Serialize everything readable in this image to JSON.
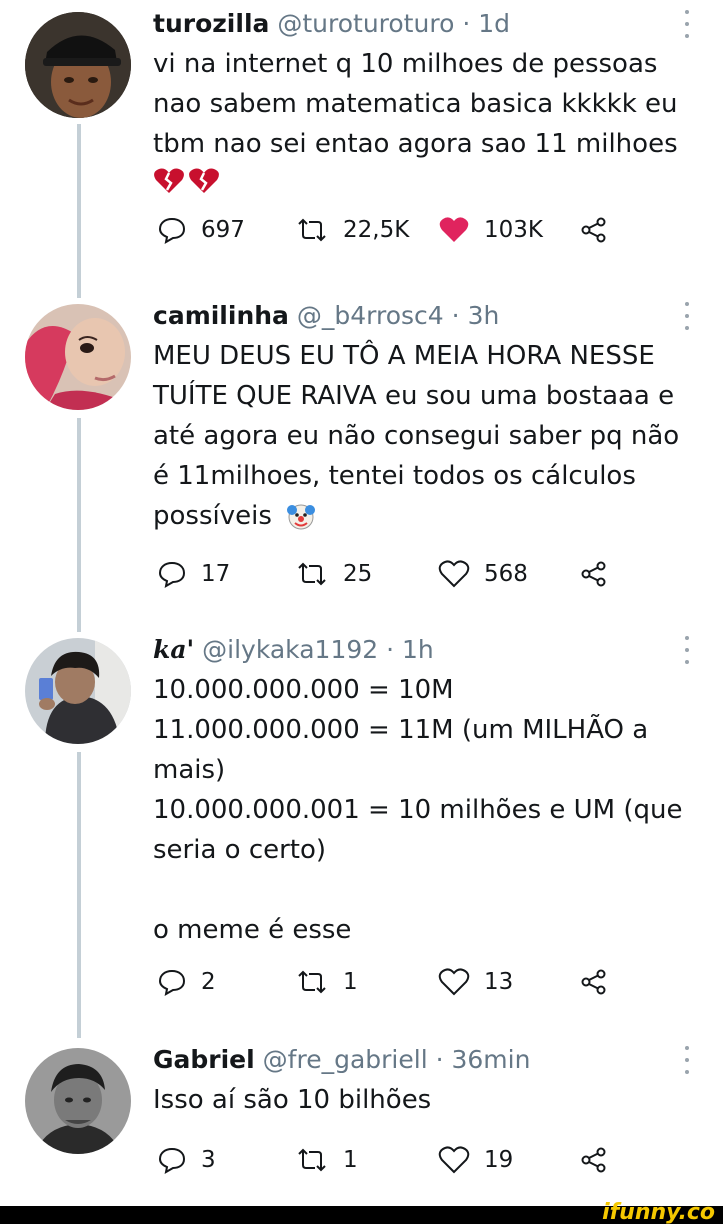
{
  "tweets": [
    {
      "name": "turozilla",
      "handle": "@turoturoturo",
      "time": "1d",
      "lines": [
        "vi na internet q 10 milhoes de pessoas",
        "nao sabem matematica basica kkkkk eu",
        "tbm nao sei entao agora sao 11 milhoes"
      ],
      "replies": "697",
      "retweets": "22,5K",
      "likes": "103K",
      "liked": true
    },
    {
      "name": "camilinha",
      "handle": "@_b4rrosc4",
      "time": "3h",
      "lines": [
        "MEU DEUS EU TÔ A MEIA HORA NESSE",
        "TUÍTE QUE RAIVA eu sou uma bostaaa e",
        "até agora eu não consegui saber pq não",
        "é 11milhoes, tentei todos os cálculos",
        "possíveis"
      ],
      "replies": "17",
      "retweets": "25",
      "likes": "568",
      "liked": false
    },
    {
      "name": "ka'",
      "handle": "@ilykaka1192",
      "time": "1h",
      "lines": [
        "10.000.000.000 = 10M",
        "11.000.000.000 = 11M (um MILHÃO a",
        "mais)",
        "10.000.000.001 = 10 milhões e UM (que",
        "seria o certo)",
        "",
        "o meme é esse"
      ],
      "replies": "2",
      "retweets": "1",
      "likes": "13",
      "liked": false
    },
    {
      "name": "Gabriel",
      "handle": "@fre_gabriell",
      "time": "36min",
      "lines": [
        "Isso aí são 10 bilhões"
      ],
      "replies": "3",
      "retweets": "1",
      "likes": "19",
      "liked": false
    }
  ],
  "separator": "·",
  "icons": {
    "reply": "reply-icon",
    "retweet": "retweet-icon",
    "like": "heart-icon",
    "share": "share-icon",
    "broken_heart": "broken-heart-emoji",
    "clown": "clown-emoji"
  },
  "colors": {
    "like_active": "#e0245e",
    "muted": "#657786",
    "thread_line": "#c4cfd6"
  },
  "footer": {
    "brand": "ifunny.co"
  }
}
